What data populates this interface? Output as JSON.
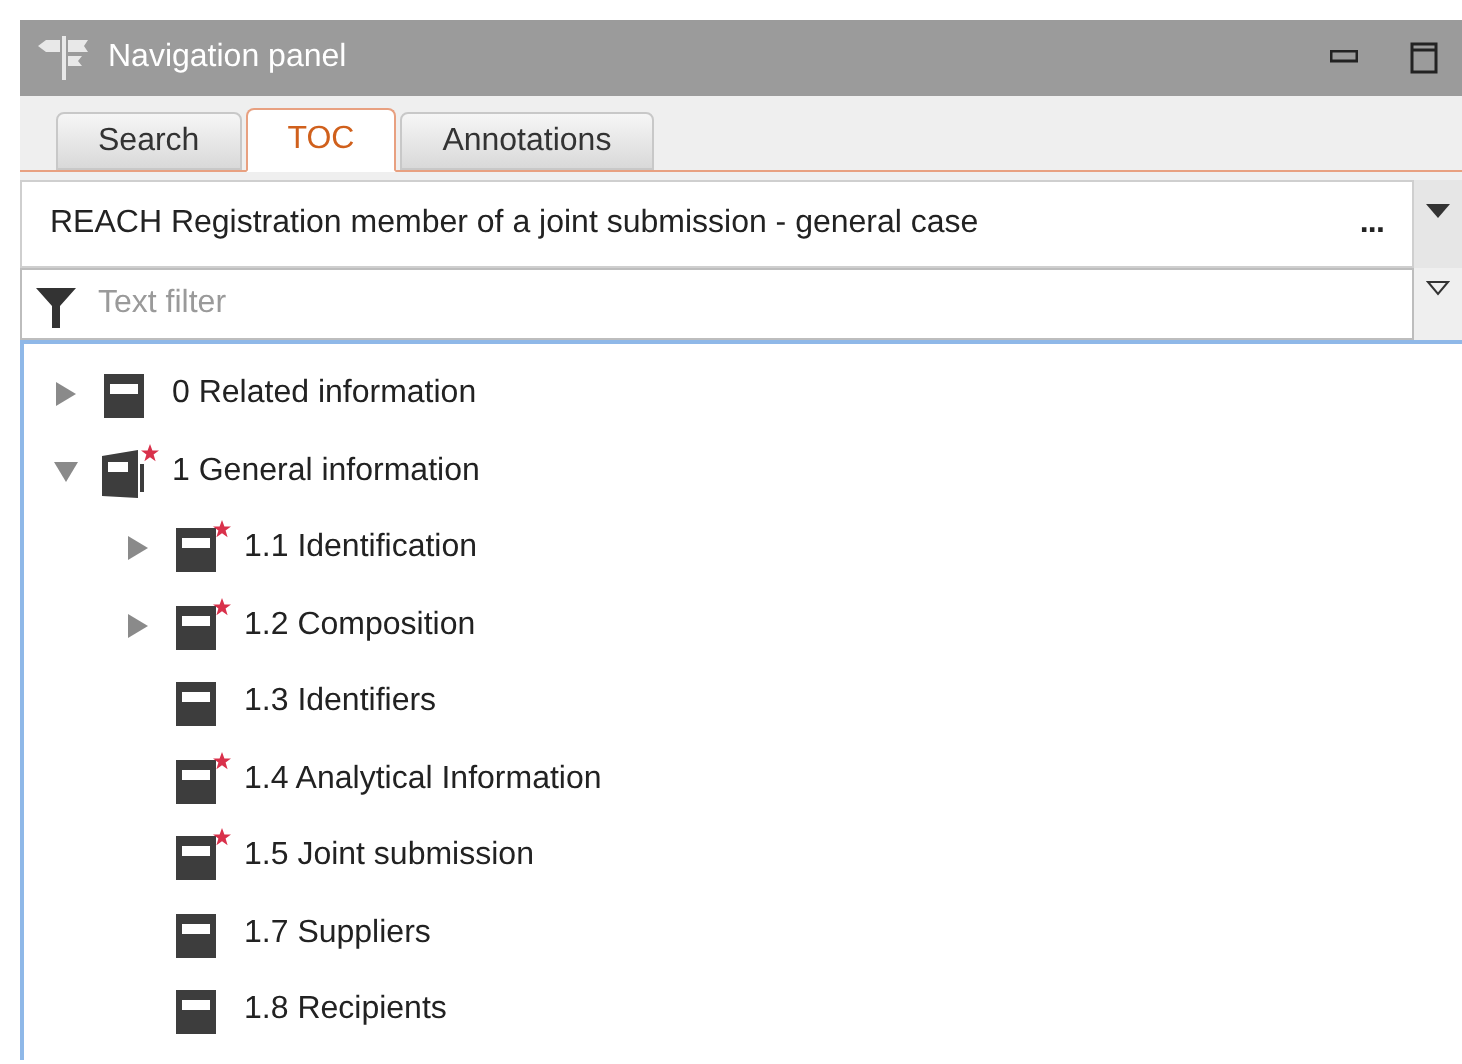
{
  "window": {
    "title": "Navigation panel"
  },
  "tabs": [
    {
      "label": "Search",
      "selected": false
    },
    {
      "label": "TOC",
      "selected": true
    },
    {
      "label": "Annotations",
      "selected": false
    }
  ],
  "template": {
    "value": "REACH Registration member of a joint submission - general case",
    "more": "..."
  },
  "filter": {
    "placeholder": "Text filter"
  },
  "tree": [
    {
      "label": "0 Related information",
      "kind": "branch",
      "expanded": false,
      "required": false
    },
    {
      "label": "1 General information",
      "kind": "branch",
      "expanded": true,
      "required": true,
      "children": [
        {
          "label": "1.1 Identification",
          "kind": "branch",
          "expanded": false,
          "required": true
        },
        {
          "label": "1.2 Composition",
          "kind": "branch",
          "expanded": false,
          "required": true
        },
        {
          "label": "1.3 Identifiers",
          "kind": "leaf",
          "required": false
        },
        {
          "label": "1.4 Analytical Information",
          "kind": "leaf",
          "required": true
        },
        {
          "label": "1.5 Joint submission",
          "kind": "leaf",
          "required": true
        },
        {
          "label": "1.7 Suppliers",
          "kind": "leaf",
          "required": false
        },
        {
          "label": "1.8 Recipients",
          "kind": "leaf",
          "required": false
        }
      ]
    }
  ]
}
